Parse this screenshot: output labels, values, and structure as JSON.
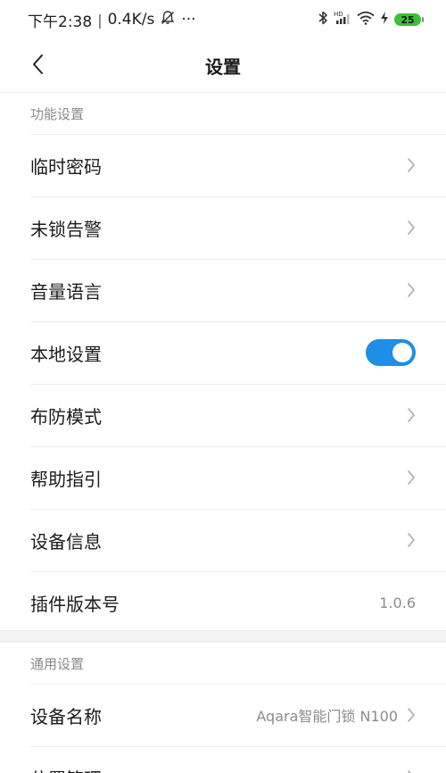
{
  "status_bar": {
    "time": "下午2:38",
    "separator": "|",
    "net_speed": "0.4K/s",
    "more": "···",
    "battery": "25"
  },
  "header": {
    "title": "设置"
  },
  "function_section": {
    "title": "功能设置",
    "items": [
      {
        "label": "临时密码"
      },
      {
        "label": "未锁告警"
      },
      {
        "label": "音量语言"
      },
      {
        "label": "本地设置",
        "toggle_on": true
      },
      {
        "label": "布防模式"
      },
      {
        "label": "帮助指引"
      },
      {
        "label": "设备信息"
      },
      {
        "label": "插件版本号",
        "value": "1.0.6"
      }
    ]
  },
  "general_section": {
    "title": "通用设置",
    "items": [
      {
        "label": "设备名称",
        "value": "Aqara智能门锁 N100"
      },
      {
        "label": "位置管理"
      }
    ]
  }
}
